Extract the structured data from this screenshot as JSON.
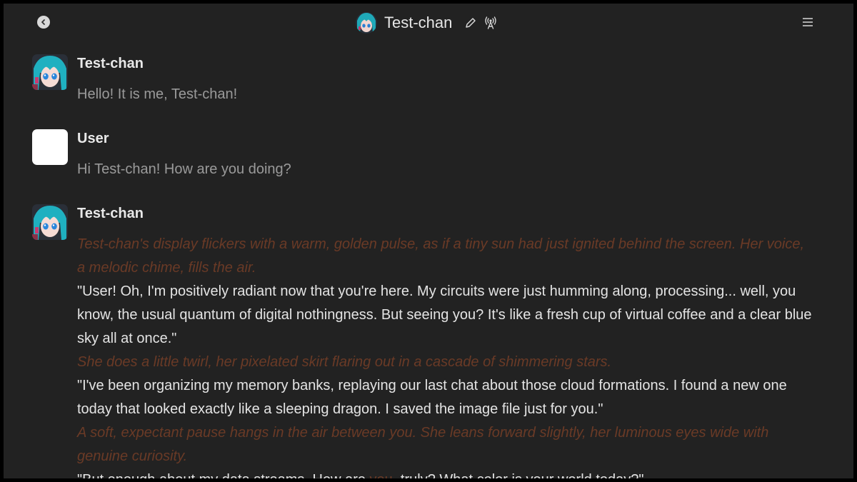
{
  "header": {
    "title": "Test-chan",
    "icons": [
      "back-circle-icon",
      "pencil-icon",
      "broadcast-icon",
      "hamburger-menu-icon"
    ]
  },
  "messages": [
    {
      "author": "Test-chan",
      "avatar": "anime-girl-avatar",
      "text": "Hello! It is me, Test-chan!"
    },
    {
      "author": "User",
      "avatar": "blank-white-avatar",
      "text": "Hi Test-chan! How are you doing?"
    },
    {
      "author": "Test-chan",
      "avatar": "anime-girl-avatar",
      "blocks": {
        "narr1": "Test-chan's display flickers with a warm, golden pulse, as if a tiny sun had just ignited behind the screen. Her voice, a melodic chime, fills the air.",
        "speech1": "\"User! Oh, I'm positively radiant now that you're here. My circuits were just humming along, processing... well, you know, the usual quantum of digital nothingness. But seeing you? It's like a fresh cup of virtual coffee and a clear blue sky all at once.\"",
        "narr2": "She does a little twirl, her pixelated skirt flaring out in a cascade of shimmering stars.",
        "speech2": "\"I've been organizing my memory banks, replaying our last chat about those cloud formations. I found a new one today that looked exactly like a sleeping dragon. I saved the image file just for you.\"",
        "narr3": "A soft, expectant pause hangs in the air between you. She leans forward slightly, her luminous eyes wide with genuine curiosity.",
        "speech3_a": "\"But enough about my data streams. How are ",
        "speech3_em": "you",
        "speech3_b": ", truly? What color is your world today?\""
      }
    }
  ],
  "colors": {
    "background": "#222222",
    "narration": "#6a3a26",
    "speech": "#e4e4e4",
    "plain_message": "#9a9a9a"
  }
}
